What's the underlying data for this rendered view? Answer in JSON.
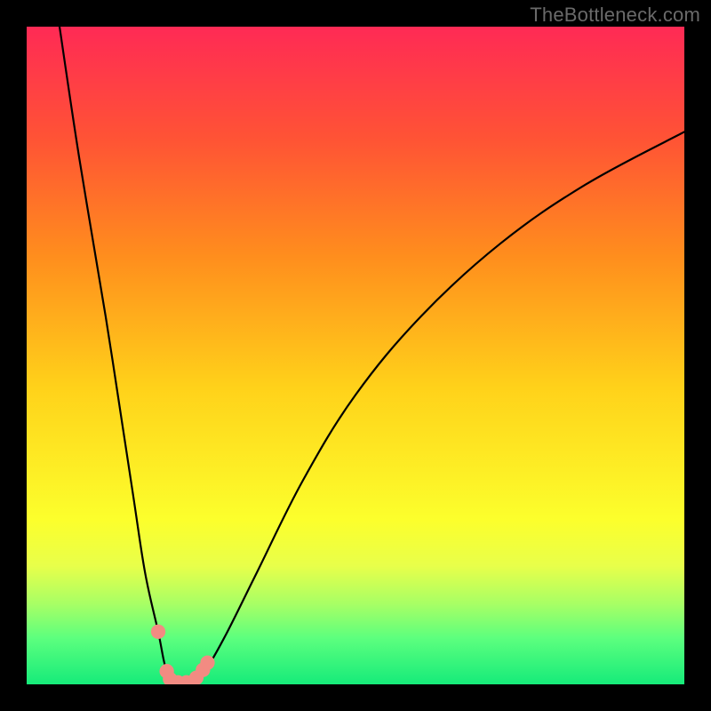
{
  "watermark": "TheBottleneck.com",
  "chart_data": {
    "type": "line",
    "title": "",
    "xlabel": "",
    "ylabel": "",
    "xlim": [
      0,
      100
    ],
    "ylim": [
      0,
      100
    ],
    "grid": false,
    "legend": false,
    "series": [
      {
        "name": "bottleneck-curve",
        "color": "#000000",
        "x": [
          5,
          8,
          12,
          16,
          18,
          20,
          21,
          22,
          23,
          24,
          25,
          27,
          30,
          35,
          42,
          50,
          60,
          72,
          85,
          100
        ],
        "y": [
          100,
          80,
          56,
          30,
          17,
          8,
          3,
          0.5,
          0,
          0,
          0.5,
          2,
          7,
          17,
          31,
          44,
          56,
          67,
          76,
          84
        ]
      }
    ],
    "markers": {
      "name": "markers",
      "color": "#f28b82",
      "radius_pct": 1.1,
      "points": [
        {
          "x": 20.0,
          "y": 8.0
        },
        {
          "x": 21.3,
          "y": 2.0
        },
        {
          "x": 21.8,
          "y": 0.8
        },
        {
          "x": 23.0,
          "y": 0.3
        },
        {
          "x": 24.3,
          "y": 0.3
        },
        {
          "x": 25.8,
          "y": 1.0
        },
        {
          "x": 26.8,
          "y": 2.2
        },
        {
          "x": 27.5,
          "y": 3.3
        }
      ]
    }
  }
}
